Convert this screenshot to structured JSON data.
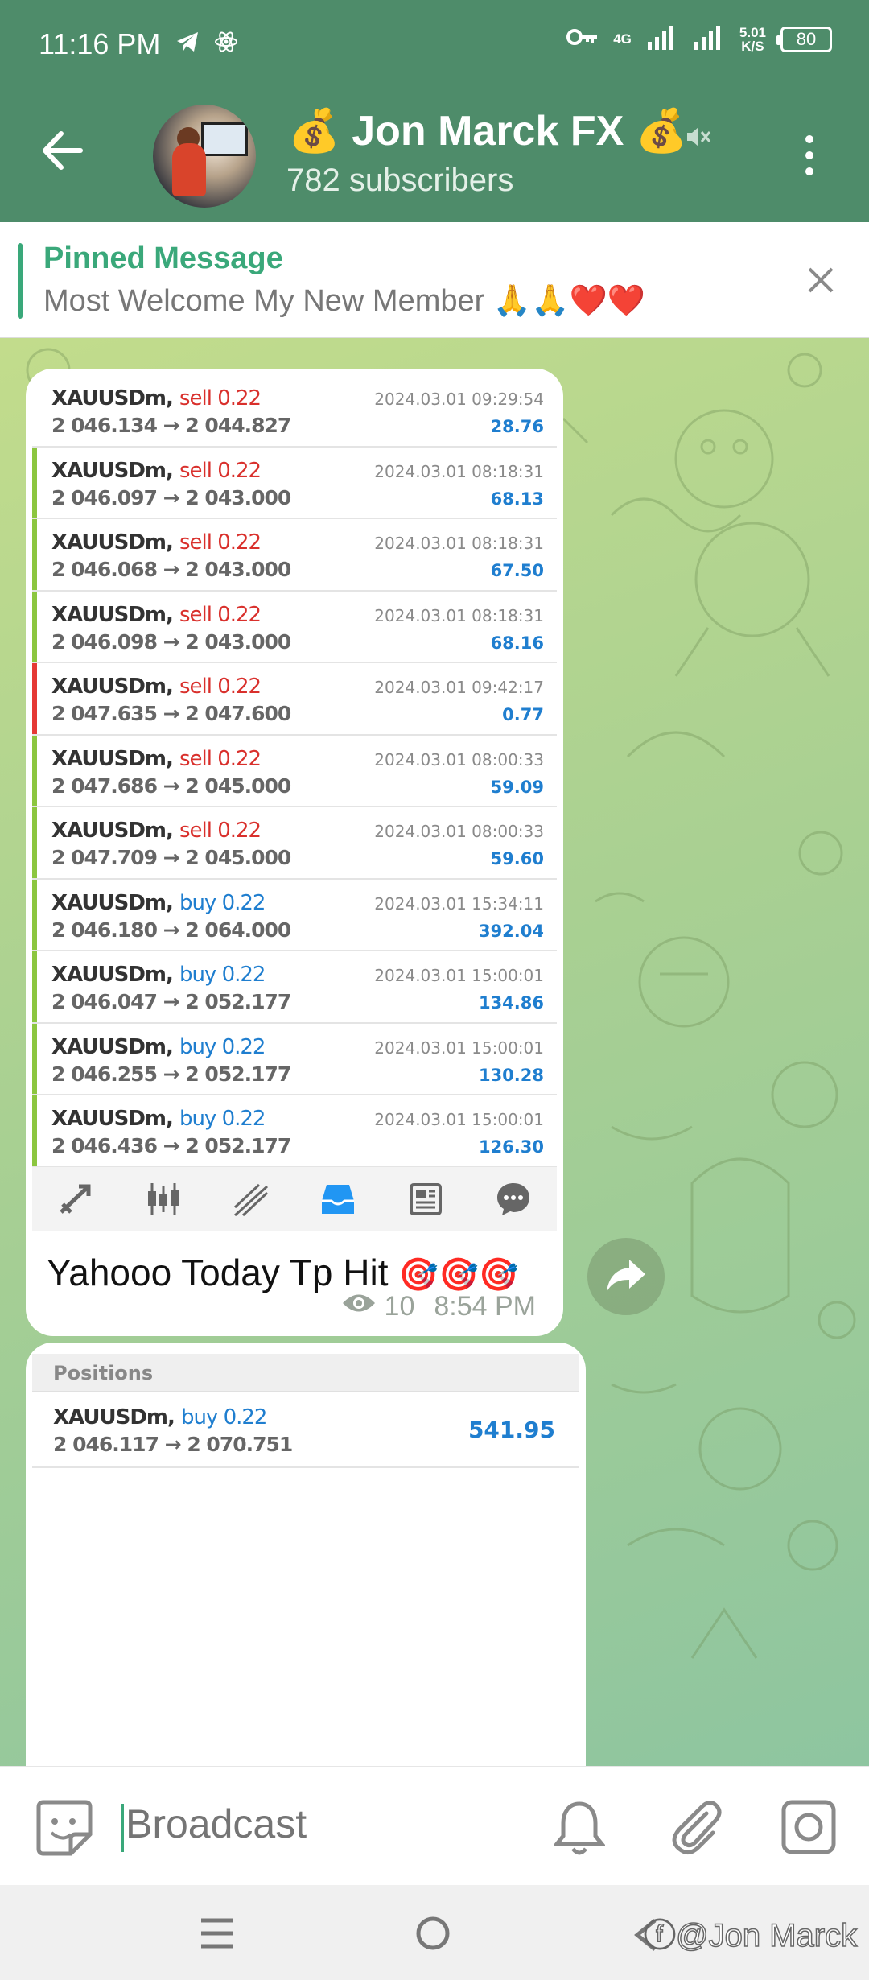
{
  "status_bar": {
    "time": "11:16 PM",
    "network": "4G",
    "speed_value": "5.01",
    "speed_unit": "K/S",
    "battery": "80"
  },
  "header": {
    "title": "💰 Jon Marck FX 💰",
    "subscribers": "782 subscribers"
  },
  "pinned": {
    "title": "Pinned Message",
    "text": "Most Welcome My New Member 🙏🙏❤️❤️"
  },
  "trades": [
    {
      "symbol": "XAUUSDm,",
      "direction": "sell 0.22",
      "type": "sell",
      "prices": "2 046.134 → 2 044.827",
      "date": "2024.03.01 09:29:54",
      "profit": "28.76",
      "accent": "#ffffff"
    },
    {
      "symbol": "XAUUSDm,",
      "direction": "sell 0.22",
      "type": "sell",
      "prices": "2 046.097 → 2 043.000",
      "date": "2024.03.01 08:18:31",
      "profit": "68.13",
      "accent": "#8cc63f"
    },
    {
      "symbol": "XAUUSDm,",
      "direction": "sell 0.22",
      "type": "sell",
      "prices": "2 046.068 → 2 043.000",
      "date": "2024.03.01 08:18:31",
      "profit": "67.50",
      "accent": "#8cc63f"
    },
    {
      "symbol": "XAUUSDm,",
      "direction": "sell 0.22",
      "type": "sell",
      "prices": "2 046.098 → 2 043.000",
      "date": "2024.03.01 08:18:31",
      "profit": "68.16",
      "accent": "#8cc63f"
    },
    {
      "symbol": "XAUUSDm,",
      "direction": "sell 0.22",
      "type": "sell",
      "prices": "2 047.635 → 2 047.600",
      "date": "2024.03.01 09:42:17",
      "profit": "0.77",
      "accent": "#e53935"
    },
    {
      "symbol": "XAUUSDm,",
      "direction": "sell 0.22",
      "type": "sell",
      "prices": "2 047.686 → 2 045.000",
      "date": "2024.03.01 08:00:33",
      "profit": "59.09",
      "accent": "#8cc63f"
    },
    {
      "symbol": "XAUUSDm,",
      "direction": "sell 0.22",
      "type": "sell",
      "prices": "2 047.709 → 2 045.000",
      "date": "2024.03.01 08:00:33",
      "profit": "59.60",
      "accent": "#8cc63f"
    },
    {
      "symbol": "XAUUSDm,",
      "direction": "buy 0.22",
      "type": "buy",
      "prices": "2 046.180 → 2 064.000",
      "date": "2024.03.01 15:34:11",
      "profit": "392.04",
      "accent": "#8cc63f"
    },
    {
      "symbol": "XAUUSDm,",
      "direction": "buy 0.22",
      "type": "buy",
      "prices": "2 046.047 → 2 052.177",
      "date": "2024.03.01 15:00:01",
      "profit": "134.86",
      "accent": "#8cc63f"
    },
    {
      "symbol": "XAUUSDm,",
      "direction": "buy 0.22",
      "type": "buy",
      "prices": "2 046.255 → 2 052.177",
      "date": "2024.03.01 15:00:01",
      "profit": "130.28",
      "accent": "#8cc63f"
    },
    {
      "symbol": "XAUUSDm,",
      "direction": "buy 0.22",
      "type": "buy",
      "prices": "2 046.436 → 2 052.177",
      "date": "2024.03.01 15:00:01",
      "profit": "126.30",
      "accent": "#8cc63f"
    }
  ],
  "toolbar_icons": [
    "trade-arrows-icon",
    "candlestick-icon",
    "chart-line-icon",
    "inbox-icon",
    "news-icon",
    "chat-bubble-icon"
  ],
  "message1": {
    "caption": "Yahooo Today Tp Hit",
    "caption_emoji": "🎯🎯🎯",
    "views": "10",
    "time": "8:54 PM"
  },
  "positions": {
    "header": "Positions",
    "symbol": "XAUUSDm,",
    "direction": "buy 0.22",
    "prices": "2 046.117 → 2 070.751",
    "profit": "541.95"
  },
  "input": {
    "placeholder": "Broadcast"
  },
  "watermark": "ⓕ@Jon Marck",
  "colors": {
    "header": "#4e8c6a",
    "accent_green": "#3aa87a",
    "sell": "#d9302c",
    "buy": "#1f7ecf"
  }
}
